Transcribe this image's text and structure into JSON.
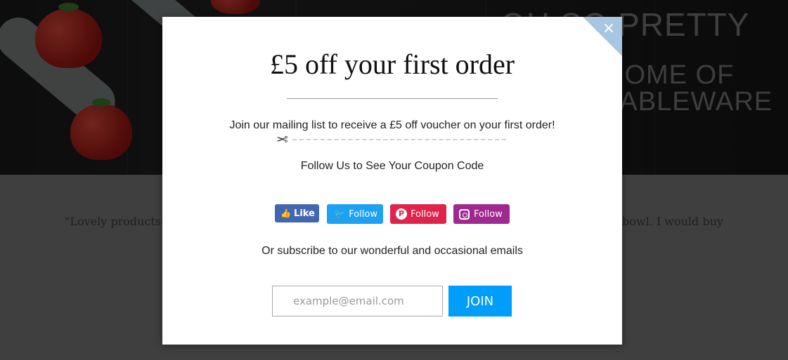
{
  "background": {
    "hero_title": "OH SO PRETTY",
    "hero_line1": "HOME OF",
    "hero_line2": "TABLEWARE",
    "quote_left": "\"Lovely products v",
    "quote_right": "bowl. I would buy"
  },
  "modal": {
    "close_label": "×",
    "headline": "£5 off your first order",
    "subtext": "Join our mailing list to receive a £5 off voucher on your first order!",
    "scissors_icon": "✂",
    "follow_heading": "Follow Us to See Your Coupon Code",
    "social": {
      "facebook_label": "Like",
      "twitter_label": "Follow",
      "pinterest_label": "Follow",
      "instagram_label": "Follow"
    },
    "subscribe_text": "Or subscribe to our wonderful and occasional emails",
    "email_placeholder": "example@email.com",
    "join_label": "JOIN"
  },
  "colors": {
    "facebook": "#4267b2",
    "twitter": "#1da1f2",
    "pinterest": "#e0234a",
    "instagram": "#a0288e",
    "join_button": "#009efb",
    "corner": "#a7c6e2"
  }
}
